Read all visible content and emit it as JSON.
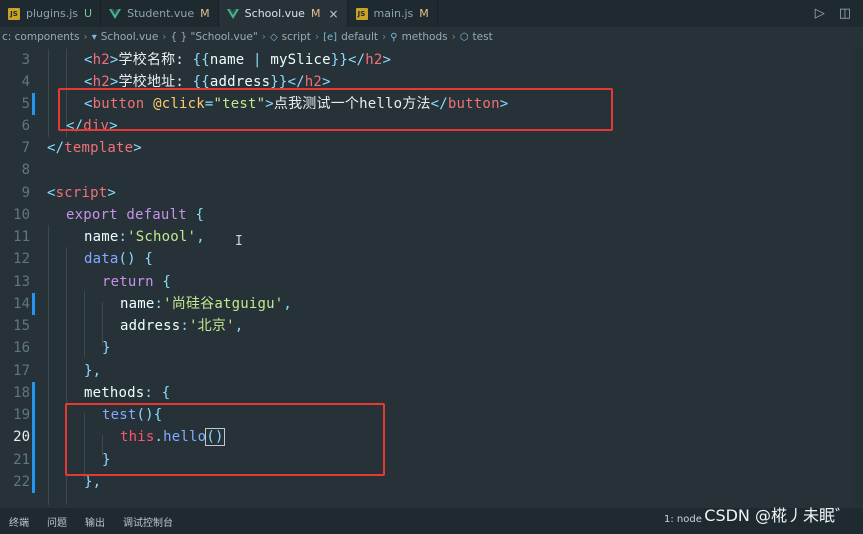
{
  "tabs": [
    {
      "label": "plugins.js",
      "status": "U",
      "icon": "js-icon",
      "active": false
    },
    {
      "label": "Student.vue",
      "status": "M",
      "icon": "vue-icon",
      "active": false
    },
    {
      "label": "School.vue",
      "status": "M",
      "icon": "vue-icon",
      "active": true
    },
    {
      "label": "main.js",
      "status": "M",
      "icon": "js-icon",
      "active": false
    }
  ],
  "tab_close": "×",
  "tab_actions": {
    "run": "▷",
    "split": "◫"
  },
  "breadcrumb": {
    "parts": [
      "c: components",
      "School.vue",
      "{ } \"School.vue\"",
      "script",
      "default",
      "methods",
      "test"
    ]
  },
  "code_lines": [
    {
      "n": "3",
      "text": "<h2>学校名称: {{name | mySlice}}</h2>"
    },
    {
      "n": "4",
      "text": "<h2>学校地址: {{address}}</h2>"
    },
    {
      "n": "5",
      "text": "<button @click=\"test\">点我测试一个hello方法</button>"
    },
    {
      "n": "6",
      "text": "</div>"
    },
    {
      "n": "7",
      "text": "</template>"
    },
    {
      "n": "8",
      "text": ""
    },
    {
      "n": "9",
      "text": "<script>"
    },
    {
      "n": "10",
      "text": "export default {"
    },
    {
      "n": "11",
      "text": "name:'School',"
    },
    {
      "n": "12",
      "text": "data() {"
    },
    {
      "n": "13",
      "text": "return {"
    },
    {
      "n": "14",
      "text": "name:'尚硅谷atguigu',"
    },
    {
      "n": "15",
      "text": "address:'北京',"
    },
    {
      "n": "16",
      "text": "}"
    },
    {
      "n": "17",
      "text": "},"
    },
    {
      "n": "18",
      "text": "methods: {"
    },
    {
      "n": "19",
      "text": "test(){"
    },
    {
      "n": "20",
      "text": "this.hello()"
    },
    {
      "n": "21",
      "text": "}"
    },
    {
      "n": "22",
      "text": "},"
    }
  ],
  "current_line": "20",
  "bottom_panel": {
    "tabs": [
      "终端",
      "问题",
      "输出",
      "调试控制台"
    ],
    "terminal_select": "1: node"
  },
  "watermark": "CSDN @椛丿未眠゛",
  "colors": {
    "background": "#263238",
    "highlight_box": "#e53935"
  }
}
